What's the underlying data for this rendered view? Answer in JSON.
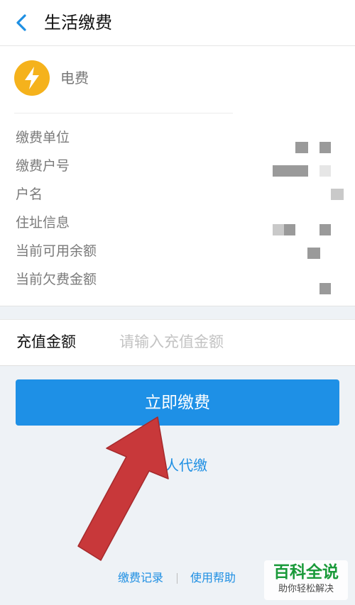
{
  "header": {
    "back_icon": "chevron-left-icon",
    "title": "生活缴费"
  },
  "bill": {
    "type_icon": "lightning-bolt-icon",
    "type_icon_color": "#f5b21c",
    "type_label": "电费",
    "fields": [
      {
        "label": "缴费单位"
      },
      {
        "label": "缴费户号"
      },
      {
        "label": "户名"
      },
      {
        "label": "住址信息"
      },
      {
        "label": "当前可用余额"
      },
      {
        "label": "当前欠费金额"
      }
    ]
  },
  "recharge": {
    "label": "充值金额",
    "value": "",
    "placeholder": "请输入充值金额"
  },
  "actions": {
    "pay_label": "立即缴费",
    "pay_color": "#1e90e6",
    "proxy_label": "人代缴"
  },
  "footer": {
    "records_label": "缴费记录",
    "help_label": "使用帮助"
  },
  "watermark": {
    "title": "百科全说",
    "subtitle": "助你轻松解决"
  },
  "annotation": {
    "arrow_color": "#c8383a"
  }
}
